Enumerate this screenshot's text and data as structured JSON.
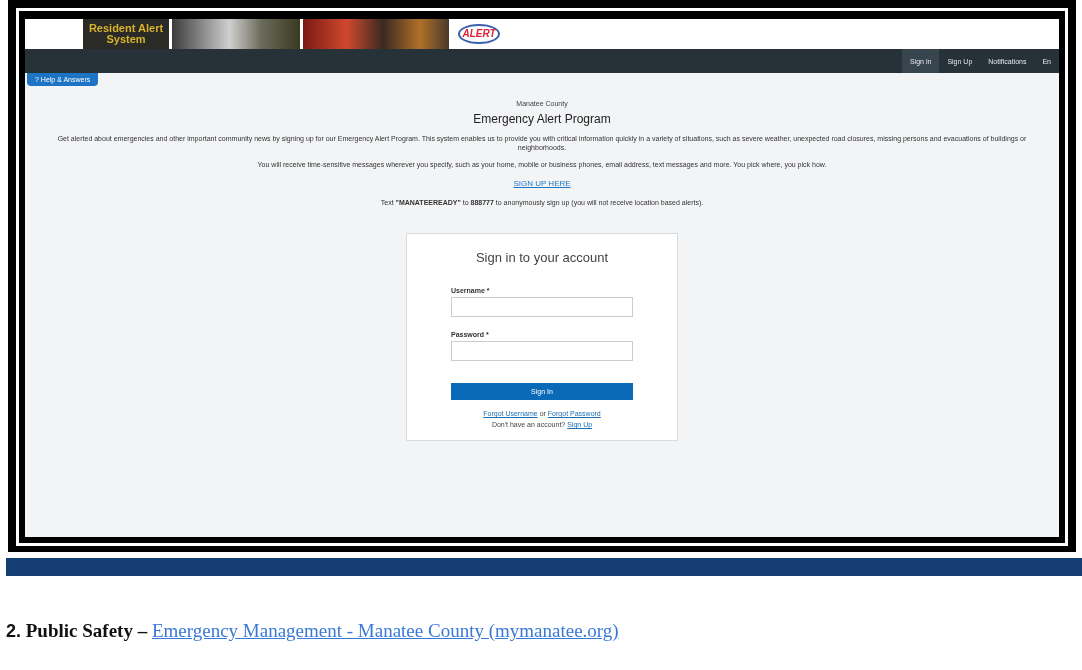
{
  "site": {
    "logo_text": "Resident Alert System",
    "alert_logo_text": "ALERT",
    "nav": [
      {
        "label": "Sign in",
        "selected": true
      },
      {
        "label": "Sign Up",
        "selected": false
      },
      {
        "label": "Notifications",
        "selected": false
      },
      {
        "label": "En",
        "selected": false
      }
    ],
    "help_button": "? Help & Answers",
    "county": "Manatee County",
    "heading": "Emergency Alert Program",
    "intro": "Get alerted about emergencies and other important community news by signing up for our Emergency Alert Program. This system enables us to provide you with critical information quickly in a variety of situations, such as severe weather, unexpected road closures, missing persons and evacuations of buildings or neighborhoods.",
    "messages": "You will receive time-sensitive messages wherever you specify, such as your home, mobile or business phones, email address, text messages and more. You pick where, you pick how.",
    "signup_link": "SIGN UP HERE",
    "text_note": "Text **\"MANATEEREADY\"** to **888777** to anonymously sign up (you will not receive location based alerts).",
    "signin": {
      "title": "Sign in to your account",
      "fields": [
        {
          "label": "Username *"
        },
        {
          "label": "Password *"
        }
      ],
      "button": "Sign In",
      "forgot_username": "Forgot Username",
      "or": "or",
      "forgot_password": "Forgot Password",
      "no_account": "Don't have an account?",
      "signup": "Sign Up"
    }
  },
  "caption": {
    "number": "2.",
    "title": "Public Safety –",
    "link": "Emergency Management - Manatee County (mymanatee.org)"
  }
}
